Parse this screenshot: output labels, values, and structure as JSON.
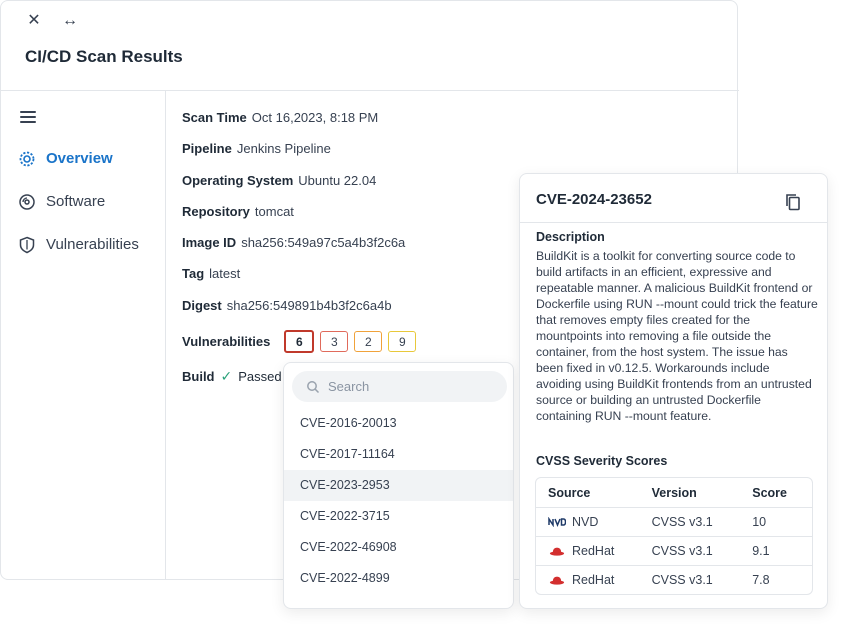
{
  "window": {
    "title": "CI/CD Scan Results"
  },
  "sidebar": {
    "items": [
      {
        "label": "Overview",
        "icon": "gear-icon",
        "active": true
      },
      {
        "label": "Software",
        "icon": "disc-icon",
        "active": false
      },
      {
        "label": "Vulnerabilities",
        "icon": "shield-icon",
        "active": false
      }
    ]
  },
  "scan": {
    "rows": [
      {
        "label": "Scan Time",
        "value": "Oct 16,2023, 8:18 PM"
      },
      {
        "label": "Pipeline",
        "value": "Jenkins Pipeline"
      },
      {
        "label": "Operating System",
        "value": "Ubuntu 22.04"
      },
      {
        "label": "Repository",
        "value": "tomcat"
      },
      {
        "label": "Image ID",
        "value": "sha256:549a97c5a4b3f2c6a"
      },
      {
        "label": "Tag",
        "value": "latest"
      },
      {
        "label": "Digest",
        "value": "sha256:549891b4b3f2c6a4b"
      }
    ],
    "vulnerabilities_label": "Vulnerabilities",
    "counts": {
      "critical": "6",
      "high": "3",
      "medium": "2",
      "low": "9"
    },
    "build_label": "Build",
    "build_status": "Passed"
  },
  "dropdown": {
    "search_placeholder": "Search",
    "items": [
      "CVE-2016-20013",
      "CVE-2017-11164",
      "CVE-2023-2953",
      "CVE-2022-3715",
      "CVE-2022-46908",
      "CVE-2022-4899"
    ],
    "selected_index": 2
  },
  "cve_card": {
    "title": "CVE-2024-23652",
    "description_heading": "Description",
    "description": "BuildKit is a toolkit for converting source code to build artifacts in an efficient, expressive and repeatable manner. A malicious BuildKit frontend or Dockerfile using RUN --mount could trick the feature that removes empty files created for the mountpoints into removing a file outside the container, from the host system. The issue has been fixed in v0.12.5. Workarounds include avoiding using BuildKit frontends from an untrusted source or building an untrusted Dockerfile containing RUN --mount feature.",
    "cvss_heading": "CVSS Severity Scores",
    "columns": [
      "Source",
      "Version",
      "Score"
    ],
    "rows": [
      {
        "source": "NVD",
        "icon": "nvd-logo-icon",
        "version": "CVSS v3.1",
        "score": "10"
      },
      {
        "source": "RedHat",
        "icon": "redhat-logo-icon",
        "version": "CVSS v3.1",
        "score": "9.1"
      },
      {
        "source": "RedHat",
        "icon": "redhat-logo-icon",
        "version": "CVSS v3.1",
        "score": "7.8"
      }
    ]
  },
  "colors": {
    "accent": "#1a74c9",
    "critical": "#c0392b",
    "high": "#e06a5b",
    "medium": "#f0a23a",
    "low": "#e8c83b",
    "passed": "#2aa27a",
    "redhat": "#d32f2f"
  }
}
